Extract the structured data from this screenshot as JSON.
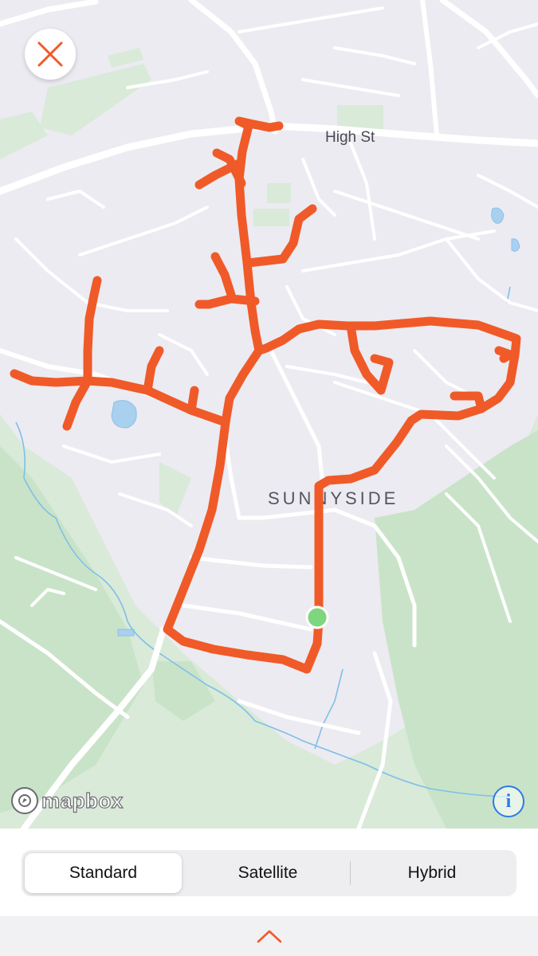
{
  "map": {
    "street_label": "High St",
    "area_label": "SUNNYSIDE",
    "attribution": "mapbox",
    "info_icon": "i",
    "route_color": "#f05a28",
    "start_marker_color": "#7ed67e"
  },
  "close_button": {
    "icon": "close-icon",
    "color": "#f05a28"
  },
  "map_style_selector": {
    "options": [
      "Standard",
      "Satellite",
      "Hybrid"
    ],
    "selected": "Standard"
  },
  "footer": {
    "icon": "chevron-up-icon",
    "color": "#f05a28"
  }
}
